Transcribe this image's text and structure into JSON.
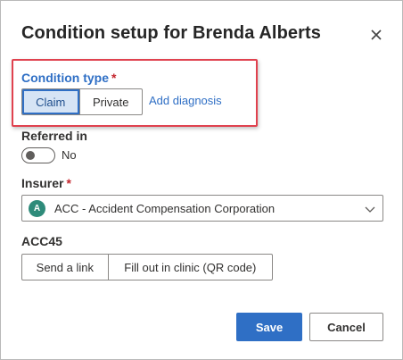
{
  "dialog": {
    "title": "Condition setup for Brenda Alberts",
    "close_icon": "close-icon"
  },
  "condition_type": {
    "label": "Condition type",
    "required_mark": "*",
    "options": [
      "Claim",
      "Private"
    ],
    "selected": "Claim",
    "add_diagnosis_link": "Add diagnosis"
  },
  "referred_in": {
    "label": "Referred in",
    "state_text": "No",
    "checked": false
  },
  "insurer": {
    "label": "Insurer",
    "required_mark": "*",
    "avatar_letter": "A",
    "avatar_color": "#2e8b7a",
    "value": "ACC - Accident Compensation Corporation",
    "chevron_icon": "chevron-down-icon"
  },
  "acc45": {
    "label": "ACC45",
    "options": [
      "Send a link",
      "Fill out in clinic (QR code)"
    ]
  },
  "footer": {
    "save_label": "Save",
    "cancel_label": "Cancel"
  },
  "colors": {
    "accent": "#2f6fc5",
    "highlight_border": "#e0424f",
    "required": "#c4262e"
  }
}
